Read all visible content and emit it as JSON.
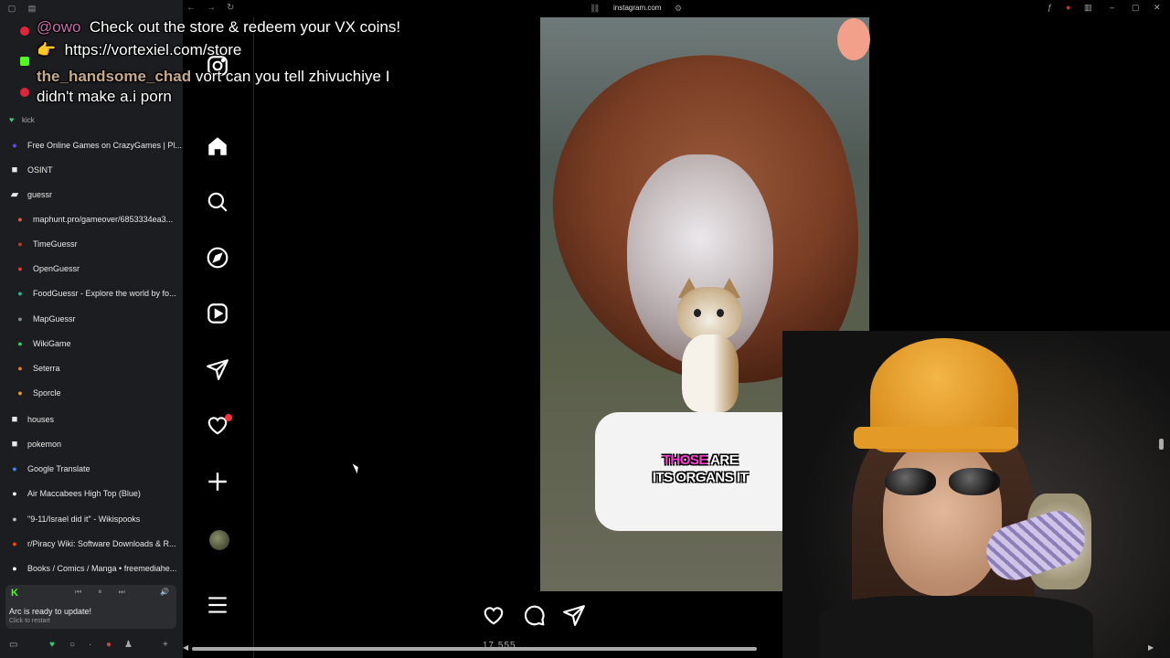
{
  "browser": {
    "url": "instagram.com",
    "pinned": [
      {
        "name": "youtube",
        "color": "#e0243a"
      },
      {
        "name": "kick",
        "color": "#53fc18"
      },
      {
        "name": "youtube-music",
        "color": "#e0243a"
      }
    ],
    "kick_label": "kick"
  },
  "sidebar": {
    "items": [
      {
        "label": "Free Online Games on CrazyGames | Pl...",
        "icon": "crazygames-icon",
        "color": "#6b4cf0"
      },
      {
        "label": "OSINT",
        "icon": "folder-icon",
        "folder": true
      },
      {
        "label": "guessr",
        "icon": "folder-open-icon",
        "folder": true
      },
      {
        "label": "maphunt.pro/gameover/6853334ea3...",
        "icon": "maphunt-icon",
        "color": "#e35a4a"
      },
      {
        "label": "TimeGuessr",
        "icon": "timeguessr-icon",
        "color": "#c0392b"
      },
      {
        "label": "OpenGuessr",
        "icon": "openguessr-icon",
        "color": "#e03c31"
      },
      {
        "label": "FoodGuessr - Explore the world by fo...",
        "icon": "foodguessr-icon",
        "color": "#1abc9c"
      },
      {
        "label": "MapGuessr",
        "icon": "mapguessr-icon",
        "color": "#7f8c8d"
      },
      {
        "label": "WikiGame",
        "icon": "wikigame-icon",
        "color": "#2ecc71"
      },
      {
        "label": "Seterra",
        "icon": "seterra-icon",
        "color": "#e67e22"
      },
      {
        "label": "Sporcle",
        "icon": "sporcle-icon",
        "color": "#f39c12"
      },
      {
        "label": "houses",
        "icon": "folder-icon",
        "folder": true
      },
      {
        "label": "pokemon",
        "icon": "folder-icon",
        "folder": true
      },
      {
        "label": "Google Translate",
        "icon": "google-translate-icon",
        "color": "#4285f4"
      },
      {
        "label": "Air Maccabees High Top (Blue)",
        "icon": "grid-icon",
        "color": "#ffffff"
      },
      {
        "label": "\"9-11/Israel did it\" - Wikispooks",
        "icon": "wikispooks-icon",
        "color": "#bbbbbb"
      },
      {
        "label": "r/Piracy Wiki: Software Downloads & R...",
        "icon": "reddit-icon",
        "color": "#ff4500"
      },
      {
        "label": "Books / Comics / Manga • freemediahe...",
        "icon": "play-icon",
        "color": "#ffffff"
      }
    ],
    "media": {
      "badge": "K",
      "title": "Arc is ready to update!",
      "subtitle": "Click to restart"
    }
  },
  "instagram": {
    "nav": [
      {
        "name": "home-icon"
      },
      {
        "name": "search-icon"
      },
      {
        "name": "explore-icon"
      },
      {
        "name": "reels-icon"
      },
      {
        "name": "messages-icon"
      },
      {
        "name": "notifications-icon"
      },
      {
        "name": "create-icon"
      },
      {
        "name": "profile-avatar"
      },
      {
        "name": "more-menu-icon"
      }
    ],
    "reel": {
      "caption_highlight": "THOSE",
      "caption_rest": " ARE",
      "caption_line2": "ITS ORGANS IT",
      "actions": [
        "like-icon",
        "comment-icon",
        "share-icon"
      ],
      "likes_partial": "17,555 ..."
    }
  },
  "chat": {
    "line1_user": "@owo",
    "line1_text": "Check out the store & redeem your VX coins!",
    "line2_emoji": "👉",
    "line2_text": "https://vortexiel.com/store",
    "line3_user": "the_handsome_chad",
    "line3_text": " vort can you tell zhivuchiye I",
    "line4_text": "didn't make a.i porn"
  },
  "colors": {
    "accent_notification": "#ff3040",
    "kick_green": "#53fc18",
    "caption_highlight": "#ff3fd2"
  }
}
